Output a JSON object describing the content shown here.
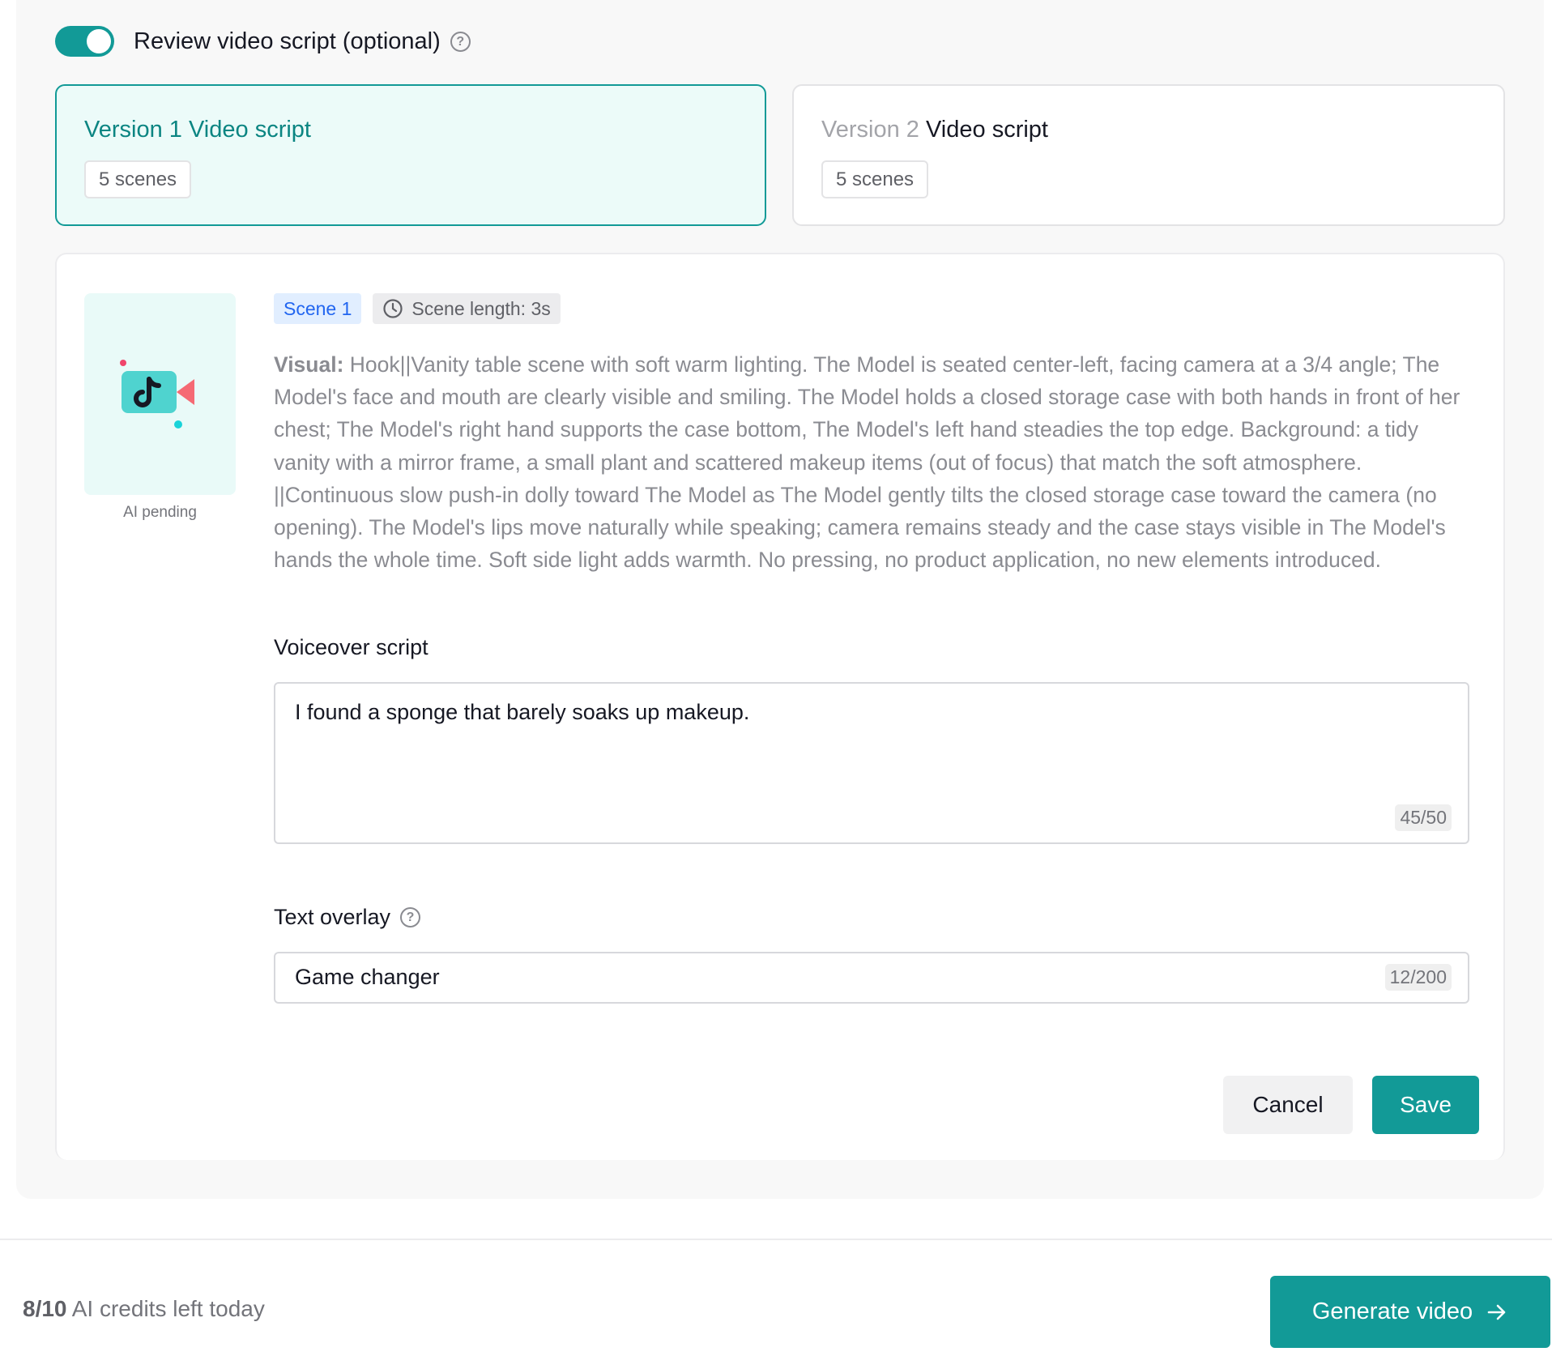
{
  "review": {
    "label": "Review video script (optional)",
    "toggle_on": true,
    "help_icon": "help-icon"
  },
  "versions": [
    {
      "prefix": "Version 1",
      "title": "Video script",
      "scenes": "5 scenes",
      "selected": true
    },
    {
      "prefix": "Version 2",
      "title": "Video script",
      "scenes": "5 scenes",
      "selected": false
    }
  ],
  "scene": {
    "thumbnail_caption": "AI pending",
    "tag": "Scene 1",
    "length": "Scene length: 3s",
    "visual_label": "Visual:",
    "visual_text": "Hook||Vanity table scene with soft warm lighting. The Model is seated center-left, facing camera at a 3/4 angle; The Model's face and mouth are clearly visible and smiling. The Model holds a closed storage case with both hands in front of her chest; The Model's right hand supports the case bottom, The Model's left hand steadies the top edge. Background: a tidy vanity with a mirror frame, a small plant and scattered makeup items (out of focus) that match the soft atmosphere. ||Continuous slow push-in dolly toward The Model as The Model gently tilts the closed storage case toward the camera (no opening). The Model's lips move naturally while speaking; camera remains steady and the case stays visible in The Model's hands the whole time. Soft side light adds warmth. No pressing, no product application, no new elements introduced.",
    "voiceover_label": "Voiceover script",
    "voiceover_value": "I found a sponge that barely soaks up makeup.",
    "voiceover_counter": "45/50",
    "overlay_label": "Text overlay",
    "overlay_value": "Game changer",
    "overlay_counter": "12/200"
  },
  "actions": {
    "cancel": "Cancel",
    "save": "Save"
  },
  "footer": {
    "credits_count": "8/10",
    "credits_text": "AI credits left today",
    "generate": "Generate video"
  },
  "colors": {
    "accent": "#129a97",
    "selected_bg": "#ecfbf9",
    "scene_tag_bg": "#e1eeff",
    "scene_tag_text": "#2266f0"
  }
}
